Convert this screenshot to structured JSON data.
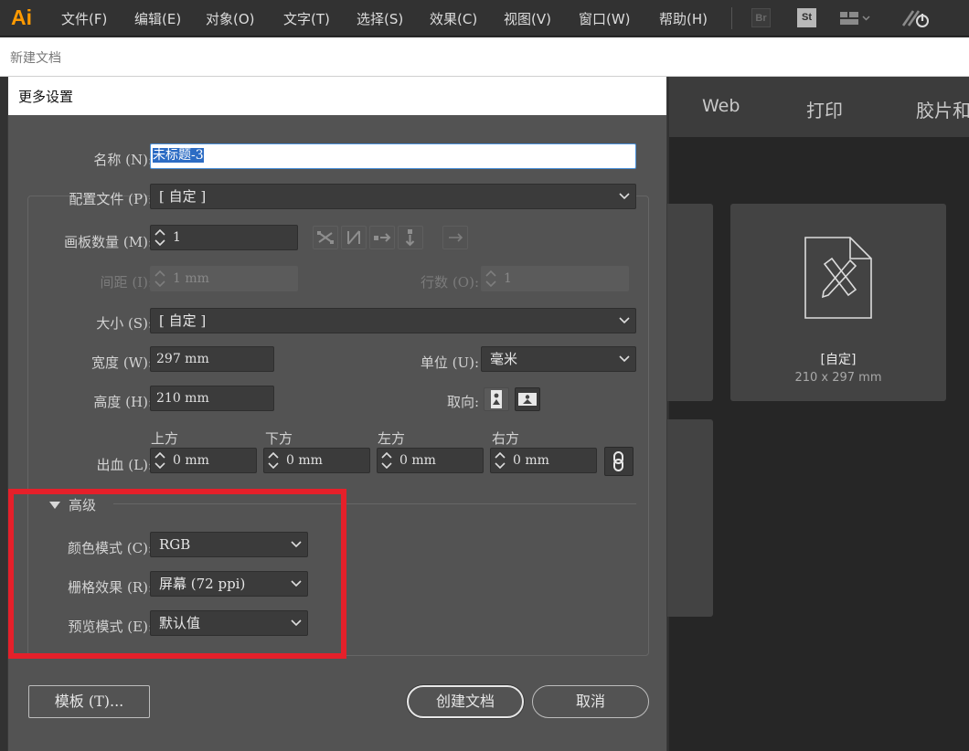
{
  "app": {
    "logo": "Ai",
    "accent_color": "#ff9a00"
  },
  "menu": [
    "文件(F)",
    "编辑(E)",
    "对象(O)",
    "文字(T)",
    "选择(S)",
    "效果(C)",
    "视图(V)",
    "窗口(W)",
    "帮助(H)"
  ],
  "bridge_badge": "Br",
  "stock_badge": "St",
  "doc_title": "新建文档",
  "background_panel": {
    "tabs": [
      "Web",
      "打印",
      "胶片和"
    ],
    "preset_label": "[自定]",
    "preset_size": "210 x 297 mm"
  },
  "dialog": {
    "title": "更多设置",
    "name_label": "名称 (N):",
    "name_value": "未标题-3",
    "profile_label": "配置文件 (P):",
    "profile_value": "[ 自定 ]",
    "artboards_label": "画板数量 (M):",
    "artboards_value": "1",
    "spacing_label": "间距 (I):",
    "spacing_value": "1 mm",
    "rows_label": "行数 (O):",
    "rows_value": "1",
    "size_label": "大小 (S):",
    "size_value": "[ 自定 ]",
    "width_label": "宽度 (W):",
    "width_value": "297 mm",
    "units_label": "单位 (U):",
    "units_value": "毫米",
    "height_label": "高度 (H):",
    "height_value": "210 mm",
    "orientation_label": "取向:",
    "bleed_label": "出血 (L):",
    "bleed_top_label": "上方",
    "bleed_top_value": "0 mm",
    "bleed_bottom_label": "下方",
    "bleed_bottom_value": "0 mm",
    "bleed_left_label": "左方",
    "bleed_left_value": "0 mm",
    "bleed_right_label": "右方",
    "bleed_right_value": "0 mm",
    "advanced_label": "高级",
    "color_mode_label": "颜色模式 (C):",
    "color_mode_value": "RGB",
    "raster_label": "栅格效果 (R):",
    "raster_value": "屏幕 (72 ppi)",
    "preview_label": "预览模式 (E):",
    "preview_value": "默认值",
    "templates_button": "模板 (T)...",
    "create_button": "创建文档",
    "cancel_button": "取消"
  },
  "highlight_color": "#e5202a"
}
